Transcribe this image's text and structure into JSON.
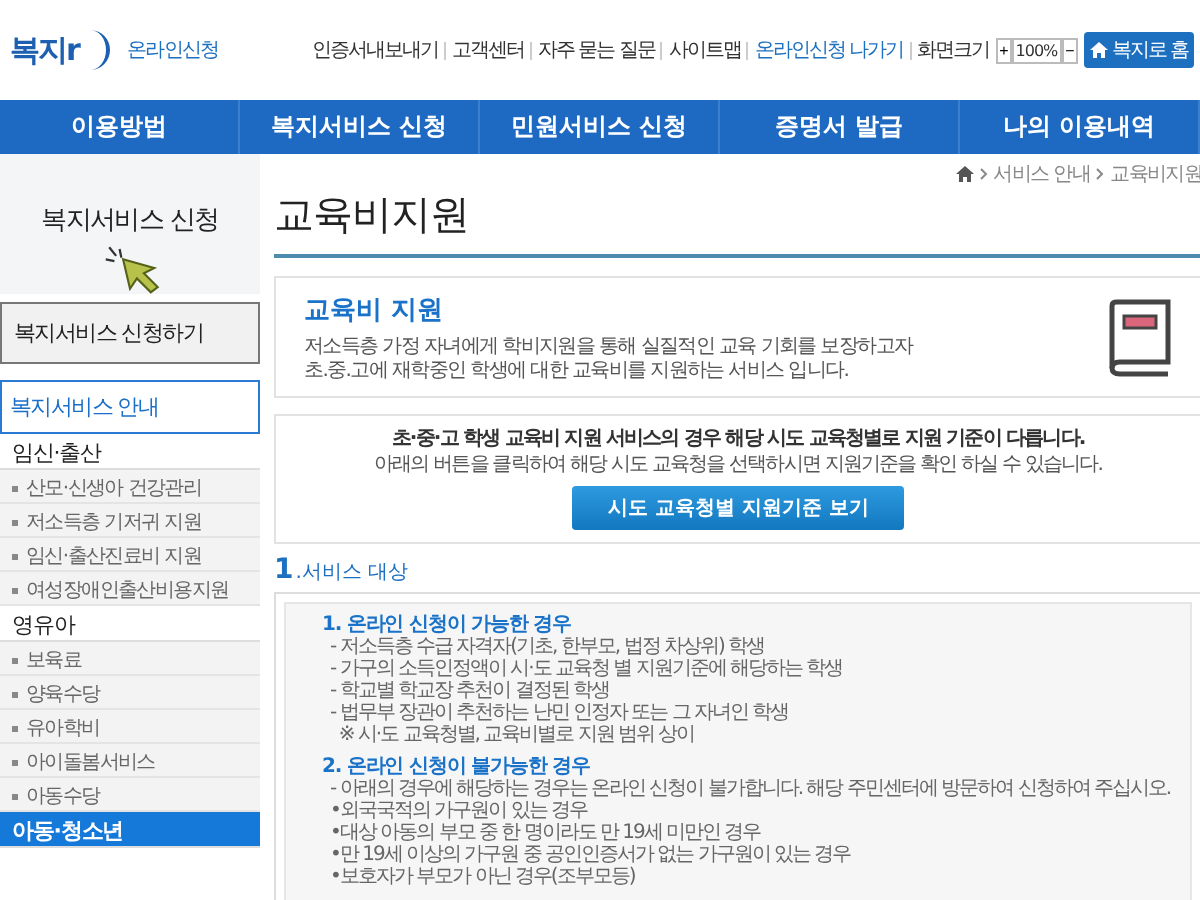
{
  "header": {
    "logo_text": "복지r",
    "logo_subtitle": "온라인신청",
    "util_links": [
      {
        "label": "인증서내보내기",
        "highlight": false
      },
      {
        "label": "고객센터",
        "highlight": false
      },
      {
        "label": "자주 묻는 질문",
        "highlight": false
      },
      {
        "label": "사이트맵",
        "highlight": false
      },
      {
        "label": "온라인신청 나가기",
        "highlight": true
      }
    ],
    "zoom": {
      "label": "화면크기",
      "plus": "+",
      "value": "100%",
      "minus": "−"
    },
    "home_button": "복지로 홈"
  },
  "nav": [
    "이용방법",
    "복지서비스 신청",
    "민원서비스 신청",
    "증명서 발급",
    "나의 이용내역"
  ],
  "sidebar": {
    "banner_title": "복지서비스 신청",
    "apply_button": "복지서비스 신청하기",
    "section_title": "복지서비스 안내",
    "groups": [
      {
        "label": "임신·출산",
        "selected": false,
        "items": [
          "산모·신생아 건강관리",
          "저소득층 기저귀 지원",
          "임신·출산진료비 지원",
          "여성장애인출산비용지원"
        ]
      },
      {
        "label": "영유아",
        "selected": false,
        "items": [
          "보육료",
          "양육수당",
          "유아학비",
          "아이돌봄서비스",
          "아동수당"
        ]
      },
      {
        "label": "아동·청소년",
        "selected": true
      }
    ]
  },
  "breadcrumb": [
    "서비스 안내",
    "교육비지원"
  ],
  "page_title": "교육비지원",
  "intro": {
    "title": "교육비 지원",
    "lines": [
      "저소득층 가정 자녀에게 학비지원을 통해 실질적인 교육 기회를 보장하고자",
      "초.중.고에 재학중인 학생에 대한 교육비를 지원하는 서비스 입니다."
    ]
  },
  "notice": {
    "lines": [
      {
        "kind": "bold",
        "text": "초·중·고 학생 교육비 지원 서비스의 경우 해당 시도 교육청별로 지원 기준이 다릅니다."
      },
      {
        "kind": "plain",
        "text": "아래의 버튼을 클릭하여 해당 시도 교육청을 선택하시면 지원기준을 확인 하실 수 있습니다."
      }
    ],
    "button": "시도 교육청별 지원기준 보기"
  },
  "section": {
    "number": "1",
    "title": ".서비스 대상",
    "groups": [
      {
        "heading": "1. 온라인 신청이 가능한 경우",
        "lines": [
          "- 저소득층 수급 자격자(기초, 한부모, 법정 차상위) 학생",
          "- 가구의 소득인정액이 시·도 교육청 별 지원기준에 해당하는 학생",
          "- 학교별 학교장 추천이 결정된 학생",
          "- 법무부 장관이 추천하는 난민 인정자 또는 그 자녀인 학생",
          "  ※ 시·도 교육청별, 교육비별로 지원 범위 상이"
        ]
      },
      {
        "heading": "2. 온라인 신청이 불가능한 경우",
        "lines": [
          "- 아래의 경우에 해당하는 경우는 온라인 신청이 불가합니다. 해당 주민센터에 방문하여 신청하여 주십시오.",
          "•외국국적의 가구원이 있는 경우",
          "•대상 아동의 부모 중 한 명이라도 만 19세 미만인 경우",
          "•만 19세 이상의 가구원 중 공인인증서가 없는 가구원이 있는 경우",
          "•보호자가 부모가 아닌 경우(조부모등)"
        ]
      }
    ]
  }
}
